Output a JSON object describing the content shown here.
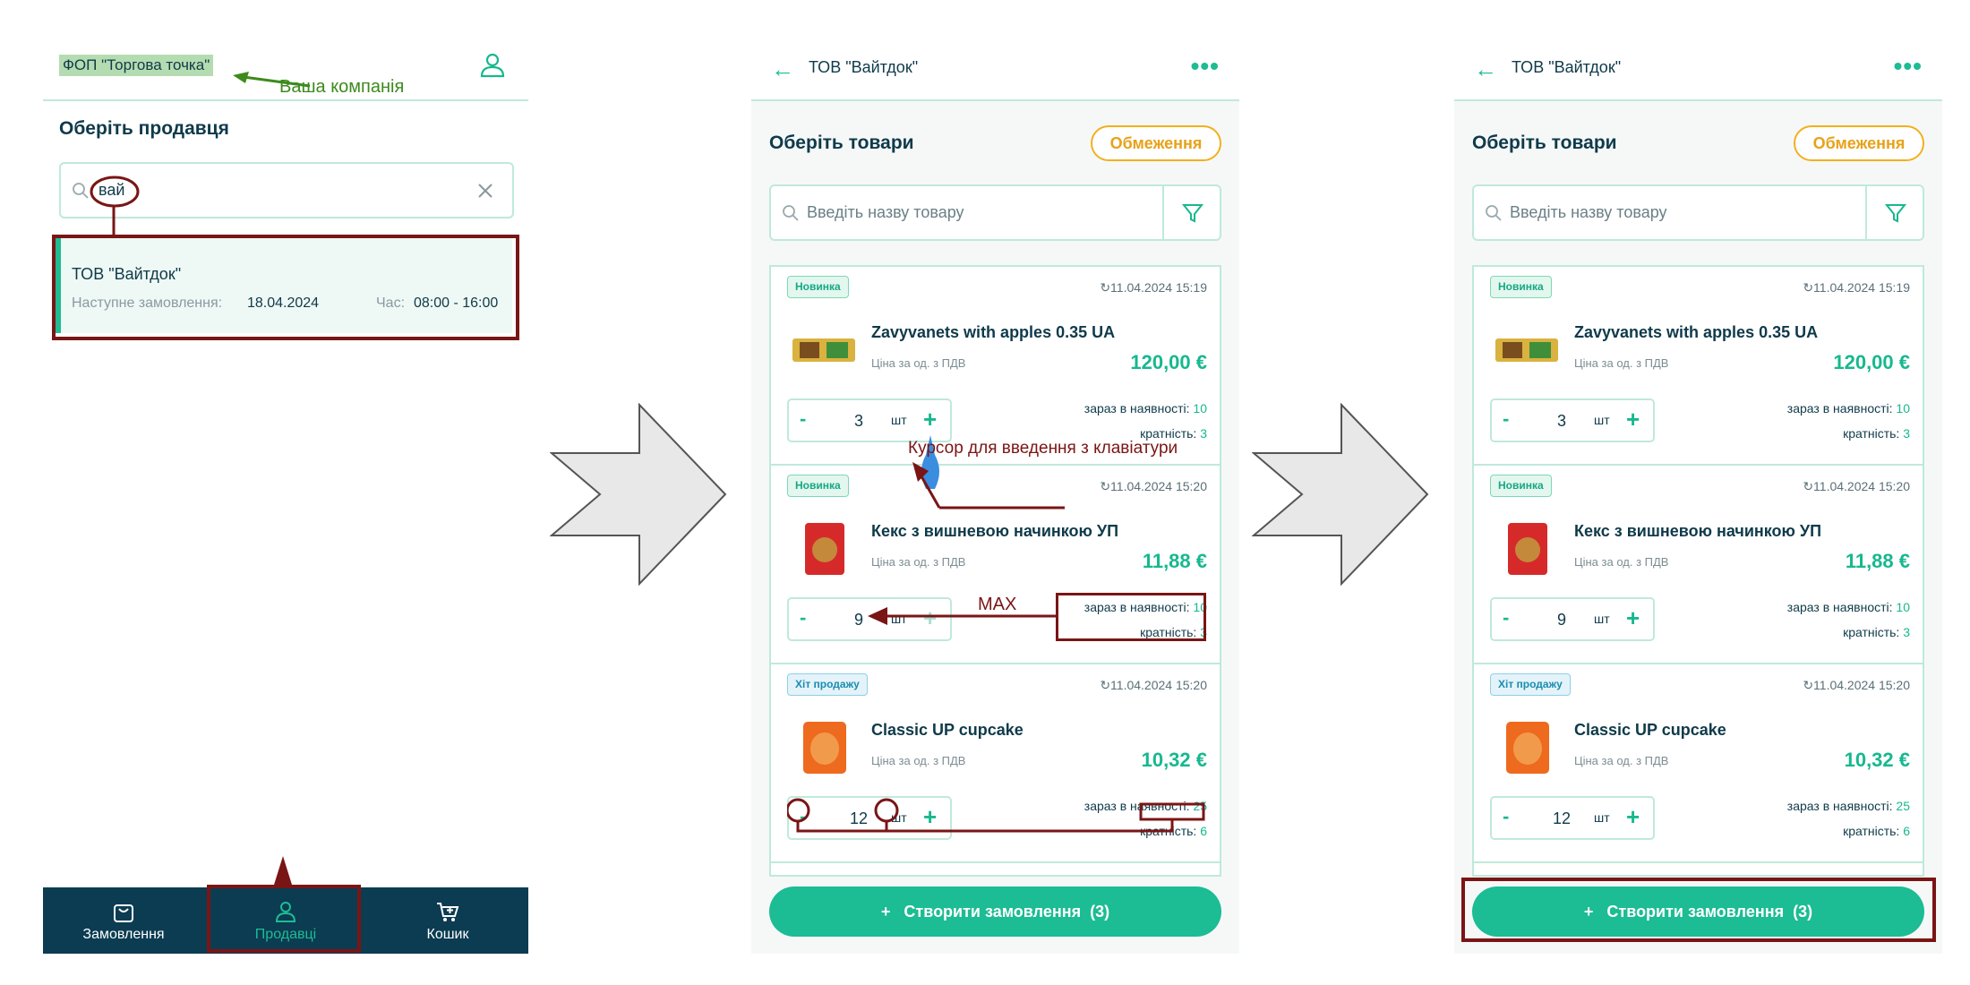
{
  "screen1": {
    "company": "ФОП \"Торгова точка\"",
    "company_note": "Ваша компанія",
    "title": "Оберіть продавця",
    "search_value": "вай",
    "vendor": {
      "name": "ТОВ \"Вайтдок\"",
      "next_order_label": "Наступне замовлення:",
      "next_order_date": "18.04.2024",
      "time_label": "Час:",
      "time_value": "08:00 - 16:00"
    },
    "nav": [
      {
        "label": "Замовлення",
        "icon": "bag-icon"
      },
      {
        "label": "Продавці",
        "icon": "user-icon"
      },
      {
        "label": "Кошик",
        "icon": "cart-icon"
      }
    ]
  },
  "shop": {
    "header": "ТОВ \"Вайтдок\"",
    "title": "Оберіть товари",
    "limits_button": "Обмеження",
    "search_placeholder": "Введіть назву товару",
    "price_note": "Ціна за од. з ПДВ",
    "unit": "шт",
    "stock_label": "зараз в наявності:",
    "mult_label": "кратність:",
    "create_button": "Створити замовлення",
    "create_count": "(3)",
    "products": [
      {
        "badge": "Новинка",
        "badge_type": "new",
        "date": "11.04.2024 15:19",
        "name": "Zavyvanets with apples 0.35 UA",
        "price": "120,00 €",
        "qty": "3",
        "stock": "10",
        "mult": "3"
      },
      {
        "badge": "Новинка",
        "badge_type": "new",
        "date": "11.04.2024 15:20",
        "name": "Кекс з вишневою начинкою УП",
        "price": "11,88 €",
        "qty": "9",
        "stock": "10",
        "mult": "3"
      },
      {
        "badge": "Хіт продажу",
        "badge_type": "hit",
        "date": "11.04.2024 15:20",
        "name": "Classic UP cupcake",
        "price": "10,32 €",
        "qty": "12",
        "stock": "25",
        "mult": "6"
      }
    ]
  },
  "annotations": {
    "cursor": "Курсор для введення з клавіатури",
    "max": "MAX"
  },
  "colors": {
    "accent": "#1cbc94",
    "annotation": "#7a1515",
    "nav_bg": "#0b3c52",
    "limits": "#f2b01e"
  }
}
